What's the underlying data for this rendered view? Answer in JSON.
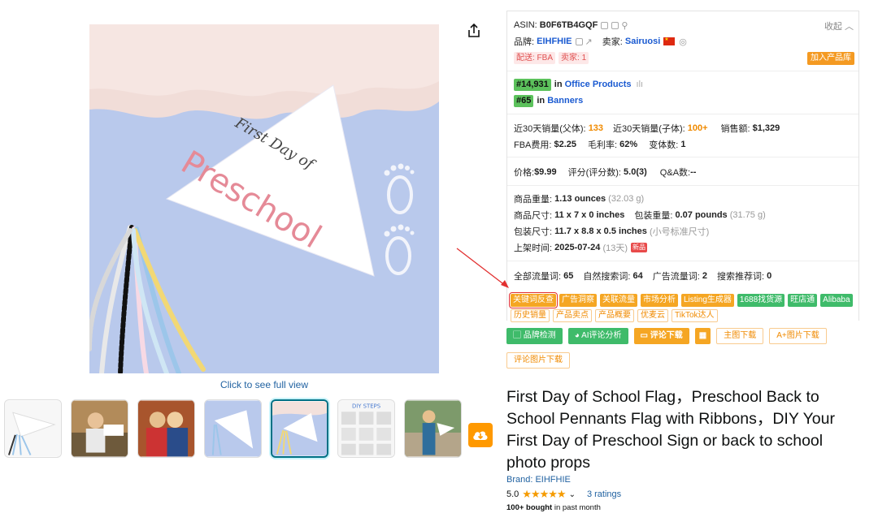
{
  "gallery": {
    "flag_line1": "First Day of",
    "flag_line2": "Preschool",
    "full_view_link": "Click to see full view",
    "diy_thumb_label": "DIY STEPS"
  },
  "panel": {
    "asin_label": "ASIN:",
    "asin": "B0F6TB4GQF",
    "collapse": "收起",
    "brand_label": "品牌:",
    "brand": "EIHFHIE",
    "seller_label": "卖家:",
    "seller": "Sairuosi",
    "tag_fba": "配送: FBA",
    "tag_sellers": "卖家: 1",
    "add_library": "加入产品库",
    "rank1_badge": "#14,931",
    "rank1_in": "in",
    "rank1_cat": "Office Products",
    "rank2_badge": "#65",
    "rank2_in": "in",
    "rank2_cat": "Banners",
    "sales_parent_label": "近30天销量(父体):",
    "sales_parent": "133",
    "sales_child_label": "近30天销量(子体):",
    "sales_child": "100+",
    "revenue_label": "销售额:",
    "revenue": "$1,329",
    "fba_fee_label": "FBA费用:",
    "fba_fee": "$2.25",
    "margin_label": "毛利率:",
    "margin": "62%",
    "variants_label": "变体数:",
    "variants": "1",
    "price_label": "价格:",
    "price": "$9.99",
    "rating_label": "评分(评分数):",
    "rating": "5.0(3)",
    "qa_label": "Q&A数:",
    "qa": "--",
    "weight_label": "商品重量:",
    "weight": "1.13 ounces",
    "weight_g": "(32.03 g)",
    "size_label": "商品尺寸:",
    "size": "11 x 7 x 0 inches",
    "pkg_weight_label": "包装重量:",
    "pkg_weight": "0.07 pounds",
    "pkg_weight_g": "(31.75 g)",
    "pkg_size_label": "包装尺寸:",
    "pkg_size": "11.7 x 8.8 x 0.5 inches",
    "pkg_size_note": "(小号标准尺寸)",
    "listed_label": "上架时间:",
    "listed": "2025-07-24",
    "listed_days": "(13天)",
    "new_tag": "新品",
    "kw_all_label": "全部流量词:",
    "kw_all": "65",
    "kw_organic_label": "自然搜索词:",
    "kw_organic": "64",
    "kw_ad_label": "广告流量词:",
    "kw_ad": "2",
    "kw_rec_label": "搜索推荐词:",
    "kw_rec": "0",
    "tools": [
      "关键词反查",
      "广告洞察",
      "关联流量",
      "市场分析",
      "Listing生成器",
      "1688找货源",
      "旺店通",
      "Alibaba",
      "历史销量",
      "产品卖点",
      "产品概要",
      "优麦云",
      "TikTok达人"
    ]
  },
  "actions": {
    "brand_check": "品牌检测",
    "ai_review": "AI评论分析",
    "review_download": "评论下载",
    "main_img_download": "主图下载",
    "aplus_download": "A+图片下载",
    "review_img_download": "评论图片下载"
  },
  "product": {
    "title": "First Day of School Flag，Preschool Back to School Pennants Flag with Ribbons，DIY Your First Day of Preschool Sign or back to school photo props",
    "brand_link": "Brand: EIHFHIE",
    "rating_value": "5.0",
    "stars": "★★★★★",
    "ratings_count": "3 ratings",
    "bought_bold": "100+ bought",
    "bought_rest": " in past month"
  },
  "colors": {
    "accent_orange": "#f5a623",
    "accent_green": "#3fbb6a",
    "link_blue": "#2162a1",
    "image_bg": "#b7c8ea"
  }
}
